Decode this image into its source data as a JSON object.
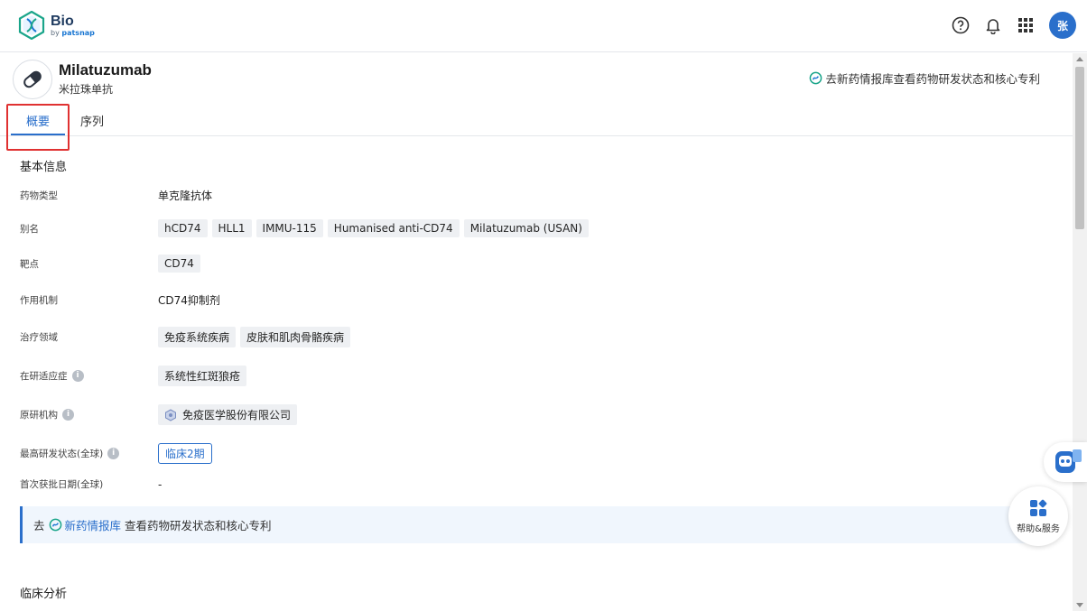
{
  "app": {
    "logo_title": "Bio",
    "logo_sub_prefix": "by ",
    "logo_sub_brand": "patsnap",
    "avatar_text": "张"
  },
  "drug": {
    "name": "Milatuzumab",
    "cn_name": "米拉珠单抗",
    "goto_link": "去新药情报库查看药物研发状态和核心专利"
  },
  "tabs": [
    {
      "label": "概要",
      "active": true
    },
    {
      "label": "序列",
      "active": false
    }
  ],
  "basic_info": {
    "title": "基本信息",
    "rows": {
      "drug_type": {
        "label": "药物类型",
        "value": "单克隆抗体"
      },
      "aliases": {
        "label": "别名",
        "tags": [
          "hCD74",
          "HLL1",
          "IMMU-115",
          "Humanised anti-CD74",
          "Milatuzumab (USAN)"
        ]
      },
      "target": {
        "label": "靶点",
        "tags": [
          "CD74"
        ]
      },
      "mechanism": {
        "label": "作用机制",
        "value": "CD74抑制剂"
      },
      "therapy_area": {
        "label": "治疗领域",
        "tags": [
          "免疫系统疾病",
          "皮肤和肌肉骨骼疾病"
        ]
      },
      "indication": {
        "label": "在研适应症",
        "tags": [
          "系统性红斑狼疮"
        ]
      },
      "originator": {
        "label": "原研机构",
        "value": "免疫医学股份有限公司"
      },
      "highest_phase": {
        "label": "最高研发状态(全球)",
        "value": "临床2期"
      },
      "first_approval": {
        "label": "首次获批日期(全球)",
        "value": "-"
      }
    }
  },
  "promo": {
    "prefix": "去",
    "brand": "新药情报库",
    "suffix": "查看药物研发状态和核心专利"
  },
  "clinical": {
    "title": "临床分析"
  },
  "help": {
    "label": "帮助&服务"
  },
  "colors": {
    "accent": "#2a6fcb",
    "highlight_box": "#e03131"
  }
}
